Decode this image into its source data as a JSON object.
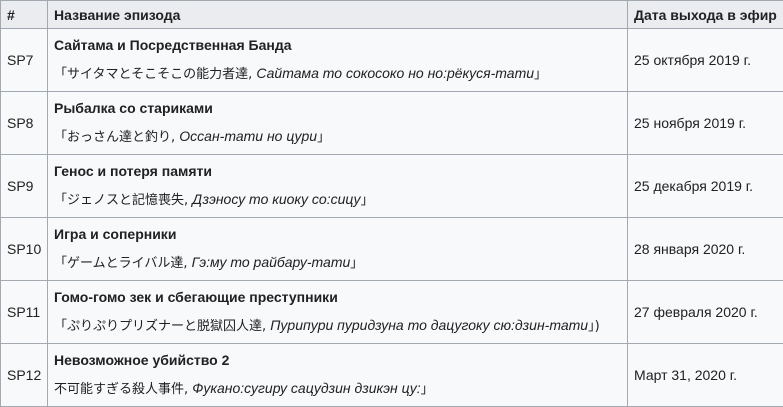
{
  "headers": {
    "num": "#",
    "title": "Название эпизода",
    "date": "Дата выхода в эфир"
  },
  "episodes": [
    {
      "num": "SP7",
      "title": "Сайтама и Посредственная Банда",
      "orig_open": "「",
      "orig_jp": "サイタマとそこそこの能力者達, ",
      "orig_romaji": "Сайтама то сокосоко но но:рёкуся-тати",
      "orig_close": "」",
      "date": "25 октября 2019 г."
    },
    {
      "num": "SP8",
      "title": "Рыбалка со стариками",
      "orig_open": "「",
      "orig_jp": "おっさん達と釣り, ",
      "orig_romaji": "Оссан-тати но цури",
      "orig_close": "」",
      "date": "25 ноября 2019 г."
    },
    {
      "num": "SP9",
      "title": "Генос и потеря памяти",
      "orig_open": "「",
      "orig_jp": "ジェノスと記憶喪失, ",
      "orig_romaji": "Дзэносу то киоку со:сицу",
      "orig_close": "」",
      "date": "25 декабря 2019 г."
    },
    {
      "num": "SP10",
      "title": "Игра и соперники",
      "orig_open": "「",
      "orig_jp": "ゲームとライバル達, ",
      "orig_romaji": "Гэ:му то райбару-тати",
      "orig_close": "」",
      "date": "28 января 2020 г."
    },
    {
      "num": "SP11",
      "title": "Гомо-гомо зек и сбегающие преступники",
      "orig_open": "「",
      "orig_jp": "ぷりぷりプリズナーと脱獄囚人達, ",
      "orig_romaji": "Пурипури пуридзуна то дацугоку сю:дзин-тати",
      "orig_close": "」)",
      "date": "27 февраля 2020 г."
    },
    {
      "num": "SP12",
      "title": "Невозможное убийство 2",
      "orig_open": "",
      "orig_jp": "不可能すぎる殺人事件, ",
      "orig_romaji": "Фукано:сугиру сацудзин дзикэн цу:",
      "orig_close": "」",
      "date": "Март 31, 2020 г."
    }
  ]
}
